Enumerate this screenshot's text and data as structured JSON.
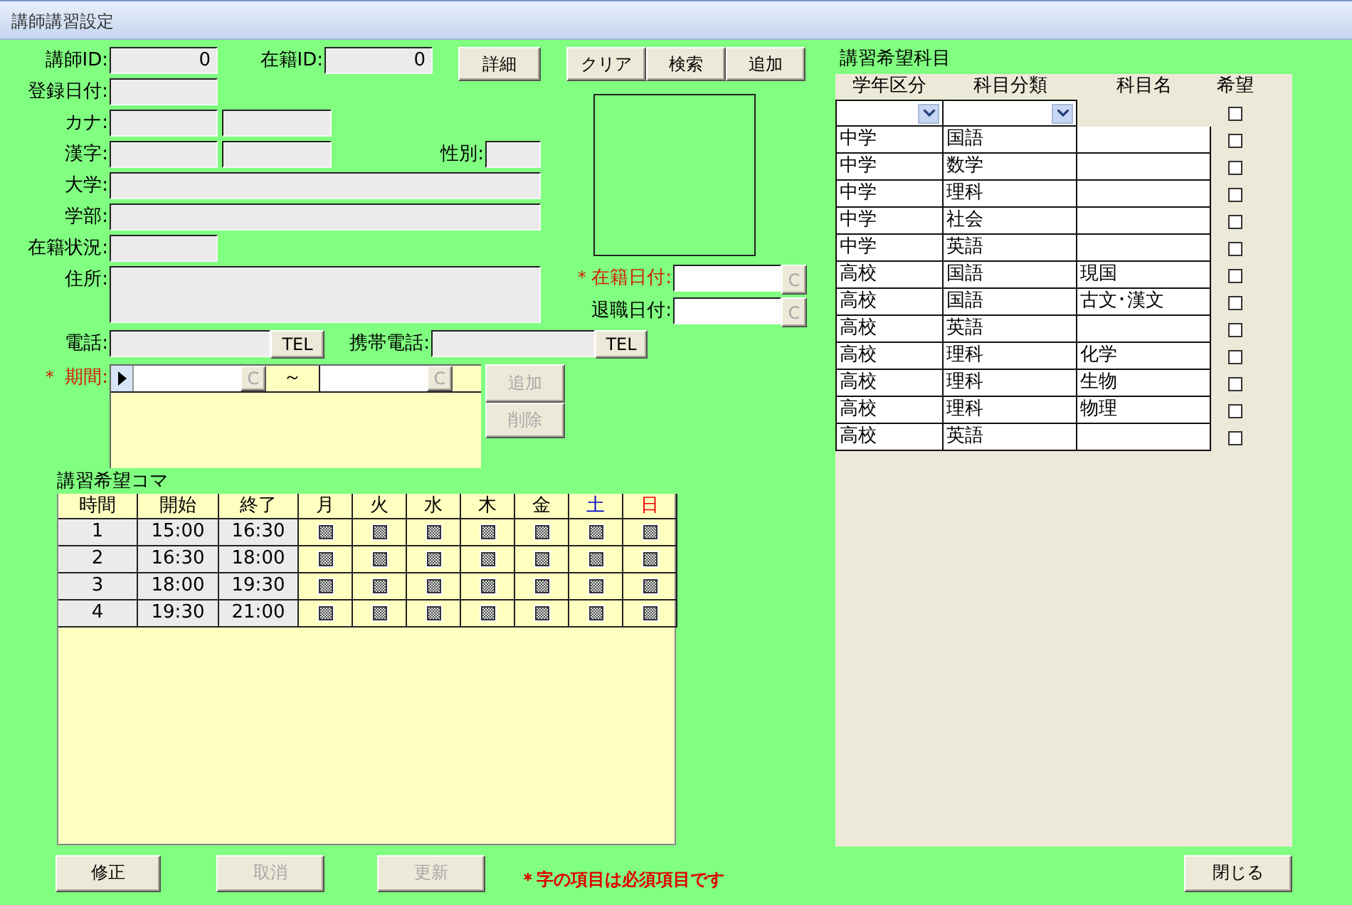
{
  "window": {
    "title": "講師講習設定"
  },
  "teacher_id": {
    "label": "講師ID:",
    "value": "0"
  },
  "enrollment_id": {
    "label": "在籍ID:",
    "value": "0"
  },
  "detail_button": "詳細",
  "action_buttons": [
    "クリア",
    "検索",
    "追加"
  ],
  "registration_date": {
    "label": "登録日付:"
  },
  "kana": {
    "label": "カナ:"
  },
  "kanji": {
    "label": "漢字:"
  },
  "gender": {
    "label": "性別:"
  },
  "university": {
    "label": "大学:"
  },
  "faculty": {
    "label": "学部:"
  },
  "status": {
    "label": "在籍状況:"
  },
  "address": {
    "label": "住所:"
  },
  "enrolled_date": {
    "label": "＊在籍日付:",
    "required": true,
    "button": "C"
  },
  "retired_date": {
    "label": "退職日付:",
    "required": false,
    "button": "C"
  },
  "phone": {
    "label": "電話:",
    "button": "TEL"
  },
  "mobile": {
    "label": "携帯電話:",
    "button": "TEL"
  },
  "period": {
    "label": "＊ 期間:",
    "required": true,
    "start_button": "C",
    "separator": "～",
    "end_button": "C",
    "buttons": [
      {
        "label": "追加",
        "disabled": true
      },
      {
        "label": "削除",
        "disabled": true
      }
    ]
  },
  "schedule": {
    "title": "講習希望コマ",
    "columns": [
      {
        "label": "時間",
        "color": "#000000"
      },
      {
        "label": "開始",
        "color": "#000000"
      },
      {
        "label": "終了",
        "color": "#000000"
      },
      {
        "label": "月",
        "color": "#000000"
      },
      {
        "label": "火",
        "color": "#000000"
      },
      {
        "label": "水",
        "color": "#000000"
      },
      {
        "label": "木",
        "color": "#000000"
      },
      {
        "label": "金",
        "color": "#000000"
      },
      {
        "label": "土",
        "color": "#0000cc"
      },
      {
        "label": "日",
        "color": "#ee0000"
      }
    ],
    "rows": [
      {
        "period": "1",
        "start": "15:00",
        "end": "16:30",
        "slots": [
          {
            "indeterminate": true
          },
          {
            "indeterminate": true
          },
          {
            "indeterminate": true
          },
          {
            "indeterminate": true
          },
          {
            "indeterminate": true
          },
          {
            "indeterminate": true
          },
          {
            "indeterminate": true
          }
        ]
      },
      {
        "period": "2",
        "start": "16:30",
        "end": "18:00",
        "slots": [
          {
            "indeterminate": true
          },
          {
            "indeterminate": true
          },
          {
            "indeterminate": true
          },
          {
            "indeterminate": true
          },
          {
            "indeterminate": true
          },
          {
            "indeterminate": true
          },
          {
            "indeterminate": true
          }
        ]
      },
      {
        "period": "3",
        "start": "18:00",
        "end": "19:30",
        "slots": [
          {
            "indeterminate": true
          },
          {
            "indeterminate": true
          },
          {
            "indeterminate": true
          },
          {
            "indeterminate": true
          },
          {
            "indeterminate": true
          },
          {
            "indeterminate": true
          },
          {
            "indeterminate": true
          }
        ]
      },
      {
        "period": "4",
        "start": "19:30",
        "end": "21:00",
        "slots": [
          {
            "indeterminate": true
          },
          {
            "indeterminate": true
          },
          {
            "indeterminate": true
          },
          {
            "indeterminate": true
          },
          {
            "indeterminate": true
          },
          {
            "indeterminate": true
          },
          {
            "indeterminate": true
          }
        ]
      }
    ]
  },
  "subjects": {
    "title": "講習希望科目",
    "columns": [
      "学年区分",
      "科目分類",
      "科目名",
      "希望"
    ],
    "filter": {
      "checked": false
    },
    "rows": [
      {
        "grade": "中学",
        "category": "国語",
        "checked": false
      },
      {
        "grade": "中学",
        "category": "数学",
        "checked": false
      },
      {
        "grade": "中学",
        "category": "理科",
        "checked": false
      },
      {
        "grade": "中学",
        "category": "社会",
        "checked": false
      },
      {
        "grade": "中学",
        "category": "英語",
        "checked": false
      },
      {
        "grade": "高校",
        "category": "国語",
        "name": "現国",
        "checked": false
      },
      {
        "grade": "高校",
        "category": "国語",
        "name": "古文･漢文",
        "checked": false
      },
      {
        "grade": "高校",
        "category": "英語",
        "checked": false
      },
      {
        "grade": "高校",
        "category": "理科",
        "name": "化学",
        "checked": false
      },
      {
        "grade": "高校",
        "category": "理科",
        "name": "生物",
        "checked": false
      },
      {
        "grade": "高校",
        "category": "理科",
        "name": "物理",
        "checked": false
      },
      {
        "grade": "高校",
        "category": "英語",
        "checked": false
      }
    ]
  },
  "footer": {
    "buttons": [
      {
        "label": "修正",
        "disabled": false
      },
      {
        "label": "取消",
        "disabled": true
      },
      {
        "label": "更新",
        "disabled": true
      }
    ],
    "note": "＊字の項目は必須項目です",
    "close_button": {
      "label": "閉じる",
      "disabled": false
    }
  }
}
